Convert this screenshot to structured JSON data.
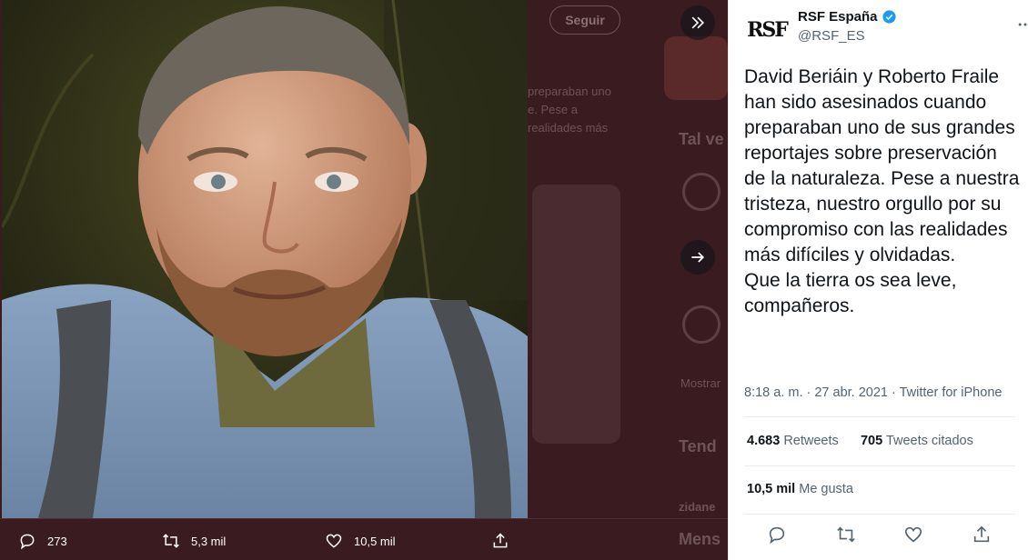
{
  "backdrop": {
    "follow_label": "Seguir",
    "snippet_lines": [
      "preparaban uno",
      "e. Pese a",
      "realidades más"
    ],
    "section_maybe": "Tal ve",
    "section_trends": "Tend",
    "section_msgs": "Mens",
    "user_zidane": "zidane",
    "more_link": "Mostrar"
  },
  "media_actions": {
    "replies": "273",
    "retweets": "5,3 mil",
    "likes": "10,5 mil"
  },
  "tweet": {
    "avatar_text": "RSF",
    "display_name": "RSF España",
    "handle": "@RSF_ES",
    "text": "David Beriáin y Roberto Fraile han sido asesinados cuando preparaban uno de sus grandes reportajes sobre preservación de la naturaleza. Pese a nuestra tristeza, nuestro orgullo por su compromiso con las realidades más difíciles y olvidadas.\nQue la tierra os sea leve, compañeros.",
    "timestamp": "8:18 a. m. · 27 abr. 2021 · Twitter for iPhone",
    "retweets_count": "4.683",
    "retweets_label": "Retweets",
    "quotes_count": "705",
    "quotes_label": "Tweets citados",
    "likes_count": "10,5 mil",
    "likes_label": "Me gusta"
  },
  "colors": {
    "accent": "#1d9bf0",
    "backdrop": "#3a1b1f",
    "panel_bg": "#ffffff",
    "icon_gray": "#536471"
  }
}
